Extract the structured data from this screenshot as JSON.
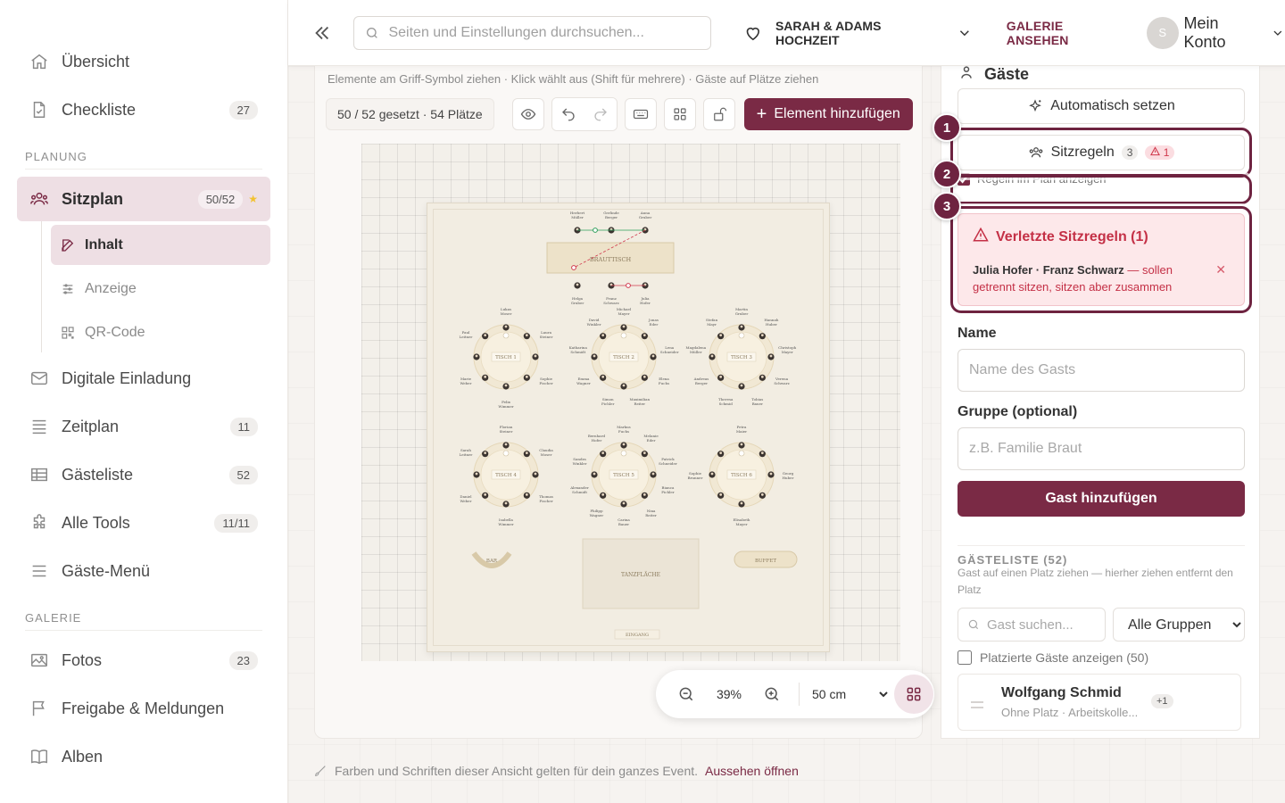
{
  "sidebar": {
    "items_top": [
      {
        "label": "Übersicht",
        "icon": "home-icon",
        "badge": ""
      },
      {
        "label": "Checkliste",
        "icon": "document-icon",
        "badge": "27"
      }
    ],
    "section_planung": "PLANUNG",
    "active": {
      "label": "Sitzplan",
      "badge": "50/52",
      "star": "★"
    },
    "sub_items": [
      {
        "label": "Inhalt"
      },
      {
        "label": "Anzeige"
      },
      {
        "label": "QR-Code"
      }
    ],
    "items_mid": [
      {
        "label": "Digitale Einladung",
        "badge": ""
      },
      {
        "label": "Zeitplan",
        "badge": "11"
      },
      {
        "label": "Gästeliste",
        "badge": "52"
      },
      {
        "label": "Alle Tools",
        "badge": "11/11"
      },
      {
        "label": "Gäste-Menü",
        "badge": ""
      }
    ],
    "section_galerie": "GALERIE",
    "items_galerie": [
      {
        "label": "Fotos",
        "badge": "23"
      },
      {
        "label": "Freigabe & Meldungen",
        "badge": ""
      },
      {
        "label": "Alben",
        "badge": ""
      }
    ]
  },
  "topbar": {
    "search_placeholder": "Seiten und Einstellungen durchsuchen...",
    "event_name": "SARAH & ADAMS HOCHZEIT",
    "gallery_link": "GALERIE ANSEHEN",
    "avatar_initial": "S",
    "account_label": "Mein Konto"
  },
  "editor": {
    "hint": "Elemente am Griff-Symbol ziehen · Klick wählt aus (Shift für mehrere) · Gäste auf Plätze ziehen",
    "count": "50 / 52 gesetzt · 54 Plätze",
    "add_element": "Element hinzufügen",
    "zoom_pct": "39%",
    "grid_size": "50 cm",
    "grid_options": [
      "50 cm"
    ]
  },
  "plan": {
    "head_table": "BRAUTTISCH",
    "tables": [
      "TISCH 1",
      "TISCH 2",
      "TISCH 3",
      "TISCH 4",
      "TISCH 5",
      "TISCH 6"
    ],
    "bar": "BAR",
    "buffet": "BUFFET",
    "dance": "TANZFLÄCHE",
    "entrance": "EINGANG",
    "head_guests": [
      "Herbert Müller",
      "Gerlinde Berger",
      "Anna Gruber",
      "Helga Gruber",
      "Franz Schwarz",
      "Julia Hofer"
    ],
    "t1_guests": [
      "Lukas Moser",
      "Laura Steiner",
      "Sophie Fischer",
      "Felix Wimmer",
      "Marie Weber",
      "Paul Leitner"
    ],
    "t2_guests": [
      "Michael Mayer",
      "Jonas Eder",
      "Lena Schneider",
      "Elena Fuchs",
      "Maximilian Reiter",
      "Simon Pichler",
      "Emma Wagner",
      "Katharina Schmidt",
      "David Winkler"
    ],
    "t3_guests": [
      "Martin Gruber",
      "Hannah Huber",
      "Christoph Mayer",
      "Verena Schwarz",
      "Tobias Bauer",
      "Theresa Schmid",
      "Andreas Berger",
      "Magdalena Müller",
      "Stefan Mayr"
    ],
    "t4_guests": [
      "Florian Steiner",
      "Claudia Moser",
      "Thomas Fischer",
      "Isabella Wimmer",
      "Daniel Weber",
      "Sarah Leitner"
    ],
    "t5_guests": [
      "Markus Fuchs",
      "Melanie Eder",
      "Patrick Schneider",
      "Bianca Pichler",
      "Nina Reiter",
      "Carina Bauer",
      "Philipp Wagner",
      "Alexander Schmidt",
      "Sandra Winkler",
      "Bernhard Hofer"
    ],
    "t6_guests": [
      "Petra Maier",
      "Georg Huber",
      "Elisabeth Mayer",
      "Sophie Brunner"
    ]
  },
  "panel": {
    "title": "Gäste",
    "auto_assign": "Automatisch setzen",
    "rules_label": "Sitzregeln",
    "rules_count": "3",
    "rules_warn": "1",
    "show_rules": "Regeln im Plan anzeigen",
    "violated_title": "Verletzte Sitzregeln (1)",
    "violated_names": "Julia Hofer · Franz Schwarz",
    "violated_text": " — sollen getrennt sitzen, sitzen aber zusammen",
    "callouts": [
      "1",
      "2",
      "3"
    ],
    "name_label": "Name",
    "name_placeholder": "Name des Gasts",
    "group_label": "Gruppe (optional)",
    "group_placeholder": "z.B. Familie Braut",
    "add_guest": "Gast hinzufügen",
    "guestlist_title": "GÄSTELISTE (52)",
    "guestlist_hint": "Gast auf einen Platz ziehen — hierher ziehen entfernt den Platz",
    "guest_search_placeholder": "Gast suchen...",
    "group_filter": "Alle Gruppen",
    "group_filter_options": [
      "Alle Gruppen"
    ],
    "show_placed": "Platzierte Gäste anzeigen (50)",
    "guest_name": "Wolfgang Schmid",
    "guest_sub": "Ohne Platz · Arbeitskolle...",
    "guest_plus": "+1"
  },
  "footer": {
    "note": "Farben und Schriften dieser Ansicht gelten für dein ganzes Event.",
    "link": "Aussehen öffnen"
  },
  "colors": {
    "accent": "#7a2a45",
    "danger": "#c43046",
    "active_bg": "#eedfe4"
  }
}
